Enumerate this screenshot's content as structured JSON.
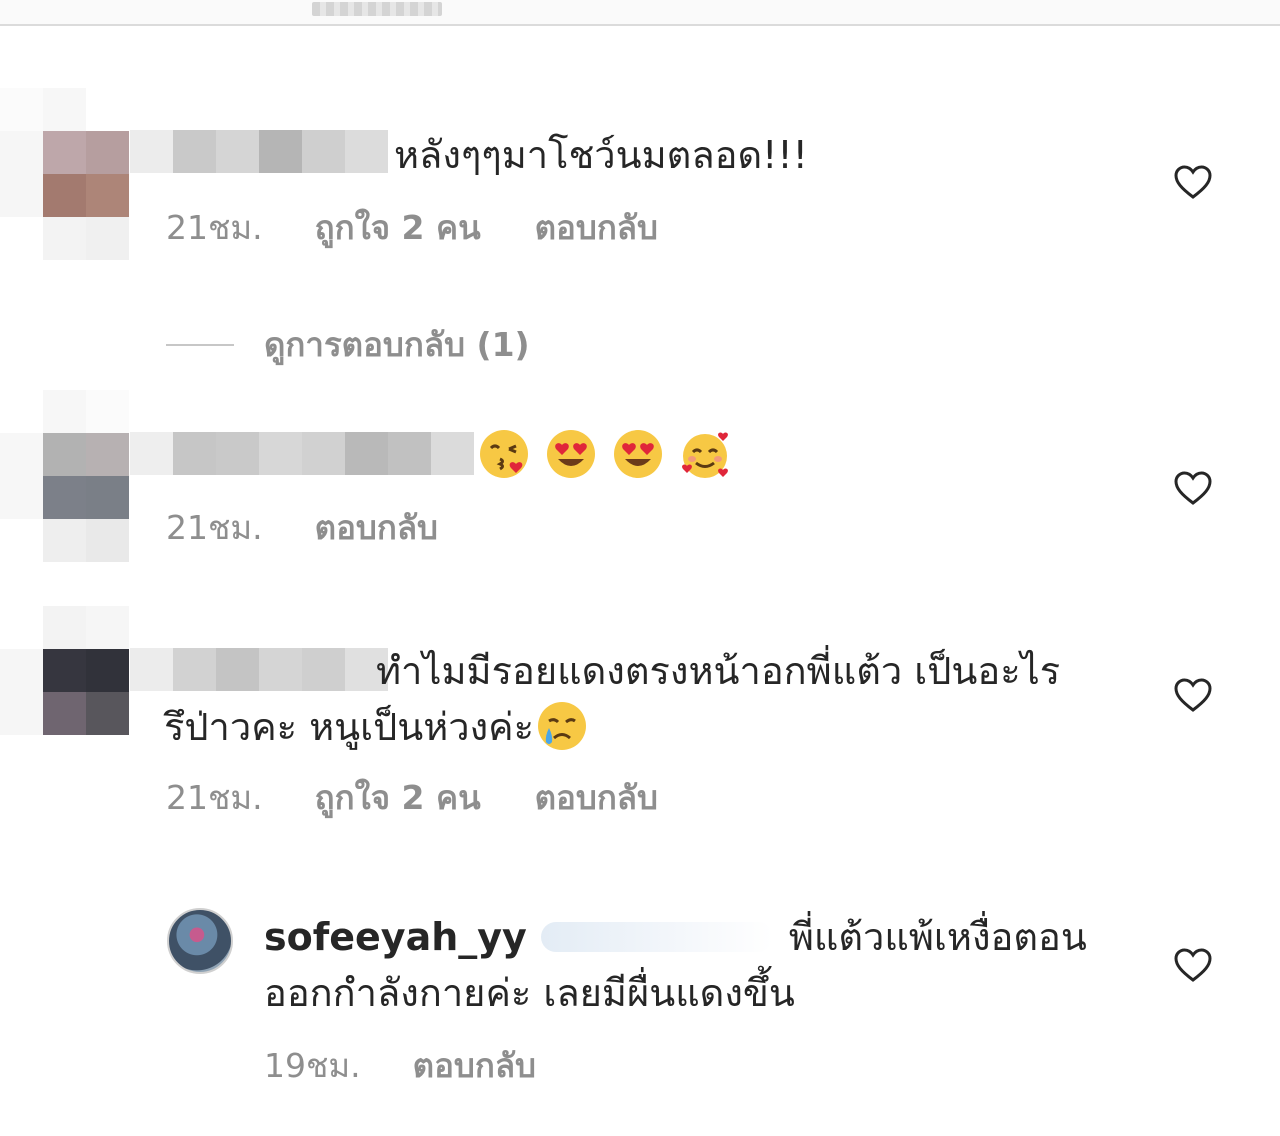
{
  "comments": [
    {
      "text": "หลังๆๆมาโชว์นมตลอด!!!",
      "time": "21ชม.",
      "likes": "ถูกใจ 2 คน",
      "reply": "ตอบกลับ"
    },
    {
      "time": "21ชม.",
      "reply": "ตอบกลับ"
    },
    {
      "text_line1": "ทำไมมีรอยแดงตรงหน้าอกพี่แต้ว เป็นอะไร",
      "text_line2": "รึป่าวคะ หนูเป็นห่วงค่ะ",
      "time": "21ชม.",
      "likes": "ถูกใจ 2 คน",
      "reply": "ตอบกลับ"
    }
  ],
  "view_replies": "ดูการตอบกลับ (1)",
  "reply_comment": {
    "username": "sofeeyah_yy",
    "text_line1": "พี่แต้วแพ้เหงื่อตอน",
    "text_line2": "ออกกำลังกายค่ะ เลยมีผื่นแดงขึ้น",
    "time": "19ชม.",
    "reply": "ตอบกลับ"
  },
  "icons": {
    "like": "heart-outline-icon",
    "emojis": [
      "kissing-face-emoji",
      "heart-eyes-emoji",
      "heart-eyes-emoji",
      "smiling-face-with-hearts-emoji"
    ],
    "crying": "crying-face-emoji"
  },
  "colors": {
    "text": "#262626",
    "meta": "#8e8e8e",
    "divider": "#dbdbdb"
  }
}
